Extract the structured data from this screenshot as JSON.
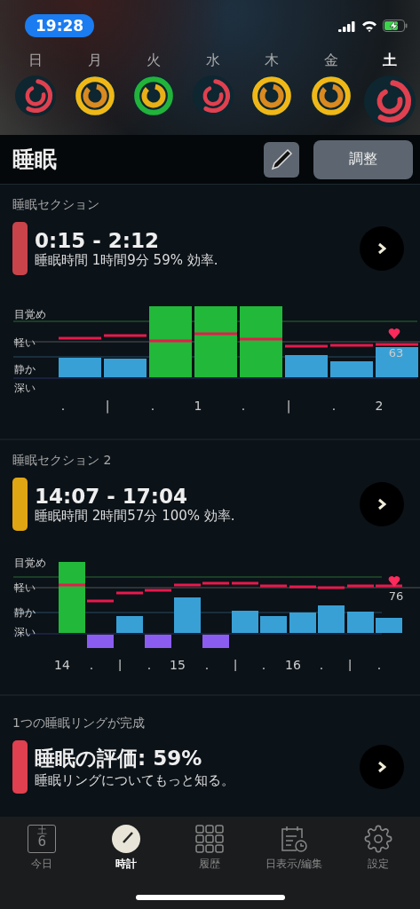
{
  "status_bar": {
    "time": "19:28"
  },
  "week": [
    {
      "label": "日",
      "selected": false,
      "kind": "partial",
      "color": "#e0404f"
    },
    {
      "label": "月",
      "selected": false,
      "kind": "complete",
      "color": "#f0b817"
    },
    {
      "label": "火",
      "selected": false,
      "kind": "complete",
      "color": "#22b33a"
    },
    {
      "label": "水",
      "selected": false,
      "kind": "partial",
      "color": "#e0404f"
    },
    {
      "label": "木",
      "selected": false,
      "kind": "complete",
      "color": "#f0b817"
    },
    {
      "label": "金",
      "selected": false,
      "kind": "complete",
      "color": "#f0b817"
    },
    {
      "label": "土",
      "selected": true,
      "kind": "partial",
      "color": "#e0404f"
    }
  ],
  "header": {
    "title": "睡眠",
    "adjust_button": "調整"
  },
  "sections": [
    {
      "label": "睡眠セクション",
      "color": "#c9434a",
      "time_range": "0:15 - 2:12",
      "summary": "睡眠時間 1時間9分 59% 効率.",
      "stages": [
        "目覚め",
        "軽い",
        "静か",
        "深い"
      ],
      "heart_rate": "63",
      "ticks": [
        ".",
        "|",
        ".",
        "1",
        ".",
        "|",
        ".",
        "2"
      ]
    },
    {
      "label": "睡眠セクション 2",
      "color": "#e0a512",
      "time_range": "14:07 - 17:04",
      "summary": "睡眠時間 2時間57分 100% 効率.",
      "stages": [
        "目覚め",
        "軽い",
        "静か",
        "深い"
      ],
      "heart_rate": "76",
      "ticks": [
        "14",
        ".",
        "|",
        ".",
        "15",
        ".",
        "|",
        ".",
        "16",
        ".",
        "|",
        "."
      ]
    }
  ],
  "rating": {
    "label": "1つの睡眠リングが完成",
    "color": "#e0404f",
    "title": "睡眠の評価: 59%",
    "subtitle": "睡眠リングについてもっと知る。"
  },
  "tab_bar": [
    {
      "label": "今日",
      "kind": "calendar",
      "icon_day": "土",
      "icon_date": "6",
      "selected": false
    },
    {
      "label": "時計",
      "kind": "clock",
      "selected": true
    },
    {
      "label": "履歴",
      "kind": "grid",
      "selected": false
    },
    {
      "label": "日表示/編集",
      "kind": "schedule",
      "selected": false
    },
    {
      "label": "設定",
      "kind": "settings",
      "selected": false
    }
  ]
}
